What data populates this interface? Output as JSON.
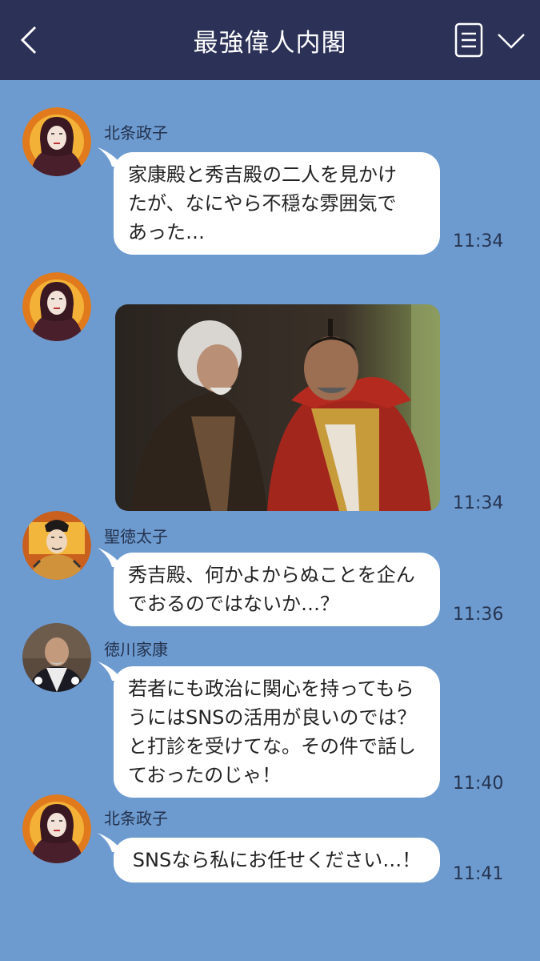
{
  "header": {
    "title": "最強偉人内閣",
    "back_icon": "chevron-left-icon",
    "memo_icon": "note-icon",
    "menu_icon": "chevron-down-icon",
    "background": "#2b3157"
  },
  "chat": {
    "background": "#6d9bd0",
    "messages": [
      {
        "sender": "北条政子",
        "lines": [
          "家康殿と秀吉殿の二人を見かけ",
          "たが、なにやら不穏な雰囲気で",
          "あった…"
        ],
        "time": "11:34"
      },
      {
        "sender": "",
        "image": "photo-two-samurai",
        "time": "11:34"
      },
      {
        "sender": "聖徳太子",
        "lines": [
          "秀吉殿、何かよからぬことを企ん",
          "でおるのではないか…？"
        ],
        "time": "11:36"
      },
      {
        "sender": "徳川家康",
        "lines": [
          "若者にも政治に関心を持ってもら",
          "うにはSNSの活用が良いのでは？",
          "と打診を受けてな。その件で話し",
          "ておったのじゃ！"
        ],
        "time": "11:40"
      },
      {
        "sender": "北条政子",
        "lines": [
          "SNSなら私にお任せください…！"
        ],
        "time": "11:41"
      }
    ]
  }
}
